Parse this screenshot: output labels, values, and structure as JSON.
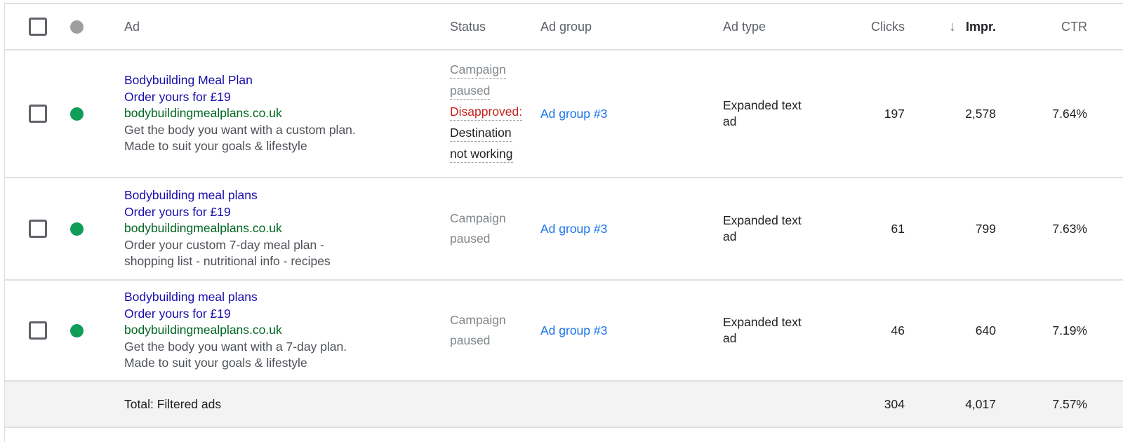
{
  "colors": {
    "headline": "#1a0dab",
    "url": "#006621",
    "ad_group_link": "#1a73e8",
    "disapproved": "#c5221f",
    "enabled_dot": "#0f9d58",
    "header_dot": "#9e9e9e",
    "total_row_bg": "#f3f3f3"
  },
  "header": {
    "ad": "Ad",
    "status": "Status",
    "ad_group": "Ad group",
    "ad_type": "Ad type",
    "clicks": "Clicks",
    "sort_icon": "arrow-down-icon",
    "sort_glyph": "↓",
    "impr": "Impr.",
    "ctr": "CTR"
  },
  "rows": [
    {
      "status_dot": "enabled",
      "ad": {
        "headline1": "Bodybuilding Meal Plan",
        "headline2": "Order yours for £19",
        "url": "bodybuildingmealplans.co.uk",
        "desc1": "Get the body you want with a custom plan.",
        "desc2": "Made to suit your goals & lifestyle"
      },
      "status": {
        "line1": "Campaign",
        "line2": "paused",
        "line3": "Disapproved:",
        "line4": "Destination",
        "line5": "not working"
      },
      "ad_group": "Ad group #3",
      "ad_type_line1": "Expanded text",
      "ad_type_line2": "ad",
      "clicks": "197",
      "impr": "2,578",
      "ctr": "7.64%"
    },
    {
      "status_dot": "enabled",
      "ad": {
        "headline1": "Bodybuilding meal plans",
        "headline2": "Order yours for £19",
        "url": "bodybuildingmealplans.co.uk",
        "desc1": "Order your custom 7-day meal plan -",
        "desc2": "shopping list - nutritional info - recipes"
      },
      "status": {
        "line1": "Campaign",
        "line2": "paused"
      },
      "ad_group": "Ad group #3",
      "ad_type_line1": "Expanded text",
      "ad_type_line2": "ad",
      "clicks": "61",
      "impr": "799",
      "ctr": "7.63%"
    },
    {
      "status_dot": "enabled",
      "ad": {
        "headline1": "Bodybuilding meal plans",
        "headline2": "Order yours for £19",
        "url": "bodybuildingmealplans.co.uk",
        "desc1": "Get the body you want with a 7-day plan.",
        "desc2": "Made to suit your goals & lifestyle"
      },
      "status": {
        "line1": "Campaign",
        "line2": "paused"
      },
      "ad_group": "Ad group #3",
      "ad_type_line1": "Expanded text",
      "ad_type_line2": "ad",
      "clicks": "46",
      "impr": "640",
      "ctr": "7.19%"
    }
  ],
  "total": {
    "label": "Total: Filtered ads",
    "clicks": "304",
    "impr": "4,017",
    "ctr": "7.57%"
  }
}
